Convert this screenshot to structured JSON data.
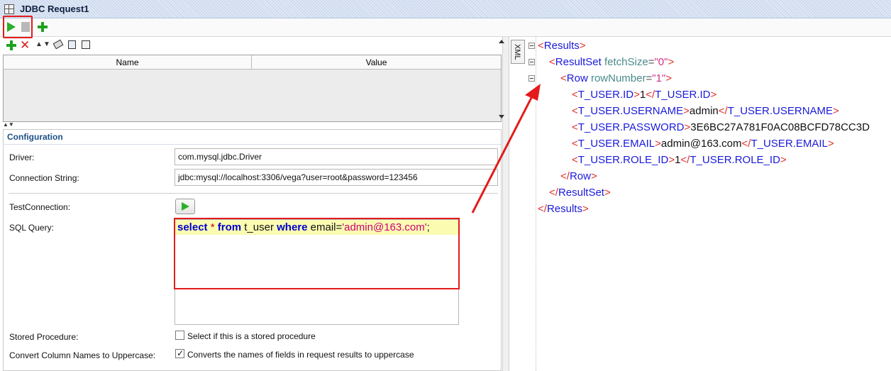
{
  "window": {
    "title": "JDBC Request1"
  },
  "params_table": {
    "columns": [
      "Name",
      "Value"
    ]
  },
  "config": {
    "title": "Configuration",
    "driver_label": "Driver:",
    "driver_value": "com.mysql.jdbc.Driver",
    "connection_label": "Connection String:",
    "connection_value": "jdbc:mysql://localhost:3306/vega?user=root&password=123456",
    "test_label": "TestConnection:",
    "sql_label": "SQL Query:",
    "sql": {
      "kw_select": "select",
      "star": " * ",
      "kw_from": "from",
      "table": " t_user ",
      "kw_where": "where",
      "field": " email=",
      "value": "'admin@163.com'",
      "end": ";"
    },
    "stored_label": "Stored Procedure:",
    "stored_text": "Select if this is a stored procedure",
    "stored_checked": false,
    "upper_label": "Convert Column Names to Uppercase:",
    "upper_text": "Converts the names of fields in request results to uppercase",
    "upper_checked": true
  },
  "xml_tab": "XML",
  "xml": {
    "results_open": "Results",
    "resultset_tag": "ResultSet",
    "resultset_attr": "fetchSize",
    "resultset_val": "\"0\"",
    "row_tag": "Row",
    "row_attr": "rowNumber",
    "row_val": "\"1\"",
    "fields": [
      {
        "tag": "T_USER.ID",
        "value": "1"
      },
      {
        "tag": "T_USER.USERNAME",
        "value": "admin"
      },
      {
        "tag": "T_USER.PASSWORD",
        "value": "3E6BC27A781F0AC08BCFD78CC3D"
      },
      {
        "tag": "T_USER.EMAIL",
        "value": "admin@163.com"
      },
      {
        "tag": "T_USER.ROLE_ID",
        "value": "1"
      }
    ],
    "row_close": "Row",
    "resultset_close": "ResultSet",
    "results_close": "Results"
  },
  "colors": {
    "accent_red": "#e31b1b",
    "run_green": "#2bb02b",
    "xml_tag_blue": "#1a1adb",
    "xml_attr_teal": "#4a8a8a",
    "xml_value_pink": "#d0308a",
    "sql_keyword": "#0000cc"
  },
  "icons": [
    "grid-icon",
    "run-icon",
    "stop-icon",
    "add-icon",
    "delete-icon",
    "move-up-icon",
    "move-down-icon",
    "eraser-icon",
    "copy-icon",
    "paste-icon",
    "fold-icon"
  ]
}
